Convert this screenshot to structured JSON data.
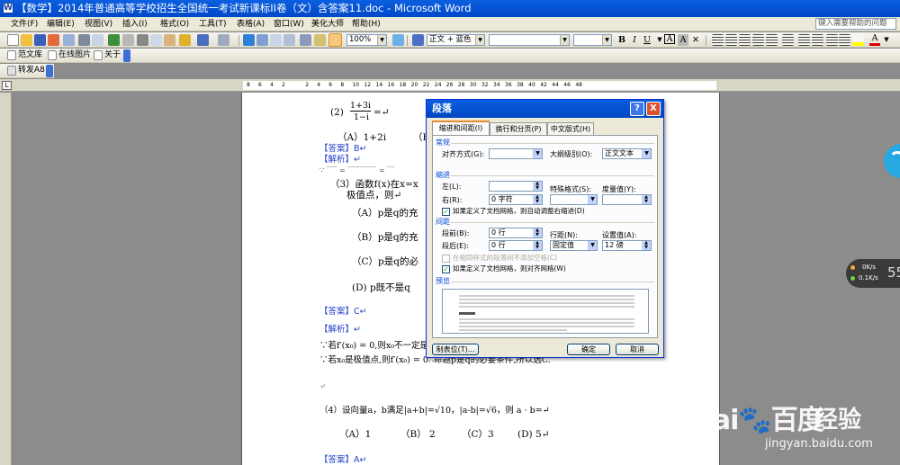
{
  "window": {
    "title": "【数学】2014年普通高等学校招生全国统一考试新课标II卷（文）含答案11.doc - Microsoft Word"
  },
  "menu": {
    "items": [
      "文件(F)",
      "编辑(E)",
      "视图(V)",
      "插入(I)",
      "格式(O)",
      "工具(T)",
      "表格(A)",
      "窗口(W)",
      "美化大师",
      "帮助(H)"
    ],
    "help_placeholder": "键入需要帮助的问题"
  },
  "toolbar": {
    "zoom": "100%",
    "style": "正文 + 蓝色",
    "font_dec_glyphs": {
      "bold": "B",
      "italic": "I",
      "underline": "U",
      "charborder": "A",
      "charshade": "A"
    },
    "font_color_letter": "A",
    "highlight_icon": "highlight-pen-icon"
  },
  "toolbar3": {
    "library_label": "范文库",
    "online_pic_label": "在线图片",
    "about_label": "关于"
  },
  "toolbar4": {
    "forward_label": "转发A8"
  },
  "ruler": {
    "ticks": [
      "8",
      "6",
      "4",
      "2",
      "2",
      "4",
      "6",
      "8",
      "10",
      "12",
      "14",
      "16",
      "18",
      "20",
      "22",
      "24",
      "26",
      "28",
      "30",
      "32",
      "34",
      "36",
      "38",
      "40",
      "42",
      "44",
      "46",
      "48"
    ],
    "corner": "L"
  },
  "document": {
    "q2_label": "(2)",
    "q2_num": "1+3i",
    "q2_den": "1−i",
    "q2_eq": "=↵",
    "q2_optA": "（A）1+2i",
    "q2_optB": "（E",
    "ans1": "【答案】B↵",
    "analysis1": "【解析】↵",
    "q3_line1": "（3）函数f(x)在x=x",
    "q3_line2": "极值点，则↵",
    "q3_A": "（A）p是q的充",
    "q3_B": "（B）p是q的充",
    "q3_C": "（C）p是q的必",
    "q3_D": "(D) p既不是q",
    "ans2": "【答案】C↵",
    "analysis2": "【解析】↵",
    "reason1": "∵若f′(x₀) = 0,则x₀不一定是",
    "reason2": "∵若x₀是极值点,则f′(x₀) = 0∴命题p是q的必要条件,所以选C.",
    "arrow": "↵",
    "q4": "（4）设向量a，b满足|a+b|=√10，|a-b|=√6，则 a · b=↵",
    "q4_opts": [
      "（A）1",
      "（B）  2",
      "（C）3",
      "(D) 5↵"
    ],
    "ans3": "【答案】A↵"
  },
  "dialog": {
    "title": "段落",
    "help_glyph": "?",
    "close_glyph": "X",
    "tabs": [
      "缩进和间距(I)",
      "换行和分页(P)",
      "中文版式(H)"
    ],
    "group_general": "常规",
    "align_label": "对齐方式(G):",
    "align_value": "",
    "outline_label": "大纲级别(O):",
    "outline_value": "正文文本",
    "group_indent": "缩进",
    "left_label": "左(L):",
    "left_value": "",
    "right_label": "右(R):",
    "right_value": "0 字符",
    "special_label": "特殊格式(S):",
    "special_value": "",
    "measure_label": "度量值(Y):",
    "measure_value": "",
    "auto_adjust_label": "如果定义了文档网格，则自动调整右缩进(D)",
    "group_spacing": "间距",
    "before_label": "段前(B):",
    "before_value": "0 行",
    "after_label": "段后(E):",
    "after_value": "0 行",
    "line_label": "行距(N):",
    "line_value": "固定值",
    "at_label": "设置值(A):",
    "at_value": "12 磅",
    "no_space_label": "在相同样式的段落间不添加空格(C)",
    "snap_grid_label": "如果定义了文档网格，则对齐网格(W)",
    "group_preview": "预览",
    "tabs_button": "制表位(T)...",
    "ok_button": "确定",
    "cancel_button": "取消"
  },
  "overlays": {
    "net_up": "0K/s",
    "net_down": "0.1K/s",
    "net_pct": "55",
    "watermark_logo": "Bai🐾百度",
    "watermark_cn": "经验",
    "watermark_url": "jingyan.baidu.com"
  }
}
